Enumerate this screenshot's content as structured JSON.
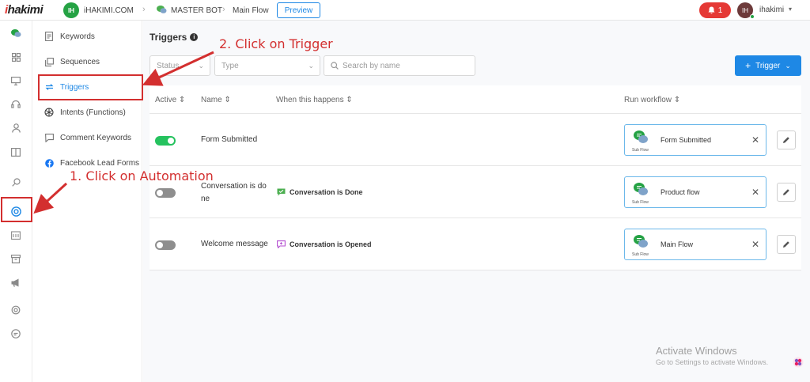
{
  "topbar": {
    "logo_prefix": "i",
    "logo_rest": "hakimi",
    "workspace_initials": "IH",
    "workspace_name": "iHAKIMI.COM",
    "bot_name": "MASTER BOT",
    "flow_name": "Main Flow",
    "preview_label": "Preview",
    "notifications_count": "1",
    "user_initials": "IH",
    "user_name": "ihakimi"
  },
  "rail": {
    "icons": [
      "chat-bubbles-icon",
      "dashboard-grid-icon",
      "monitor-icon",
      "headset-icon",
      "user-icon",
      "book-icon",
      "search-icon",
      "automation-icon",
      "calendar-icon",
      "archive-icon",
      "megaphone-icon",
      "settings-gear-icon",
      "help-icon"
    ]
  },
  "subnav": {
    "items": [
      {
        "label": "Keywords",
        "icon": "document-icon"
      },
      {
        "label": "Sequences",
        "icon": "stack-icon"
      },
      {
        "label": "Triggers",
        "icon": "triggers-icon"
      },
      {
        "label": "Intents (Functions)",
        "icon": "openai-icon"
      },
      {
        "label": "Comment Keywords",
        "icon": "comment-icon"
      },
      {
        "label": "Facebook Lead Forms",
        "icon": "facebook-icon"
      }
    ]
  },
  "main": {
    "title": "Triggers",
    "filters": {
      "status_placeholder": "Status",
      "type_placeholder": "Type",
      "search_placeholder": "Search by name"
    },
    "new_trigger_label": "Trigger",
    "columns": {
      "active": "Active",
      "name": "Name",
      "when": "When this happens",
      "workflow": "Run workflow"
    },
    "rows": [
      {
        "active": true,
        "name": "Form Submitted",
        "condition": "",
        "workflow": "Form Submitted",
        "workflow_sub": "Sub Flow"
      },
      {
        "active": false,
        "name": "Conversation is done",
        "condition": "Conversation is Done",
        "workflow": "Product flow",
        "workflow_sub": "Sub Flow"
      },
      {
        "active": false,
        "name": "Welcome message",
        "condition": "Conversation is Opened",
        "workflow": "Main Flow",
        "workflow_sub": "Sub Flow"
      }
    ]
  },
  "annotations": {
    "step1": "1. Click on Automation",
    "step2": "2. Click on Trigger"
  },
  "watermark": {
    "title": "Activate Windows",
    "subtitle": "Go to Settings to activate Windows."
  },
  "colors": {
    "accent": "#1e88e5",
    "annotation": "#d32f2f",
    "toggle_on": "#25c25e",
    "brand_green": "#25a244"
  }
}
